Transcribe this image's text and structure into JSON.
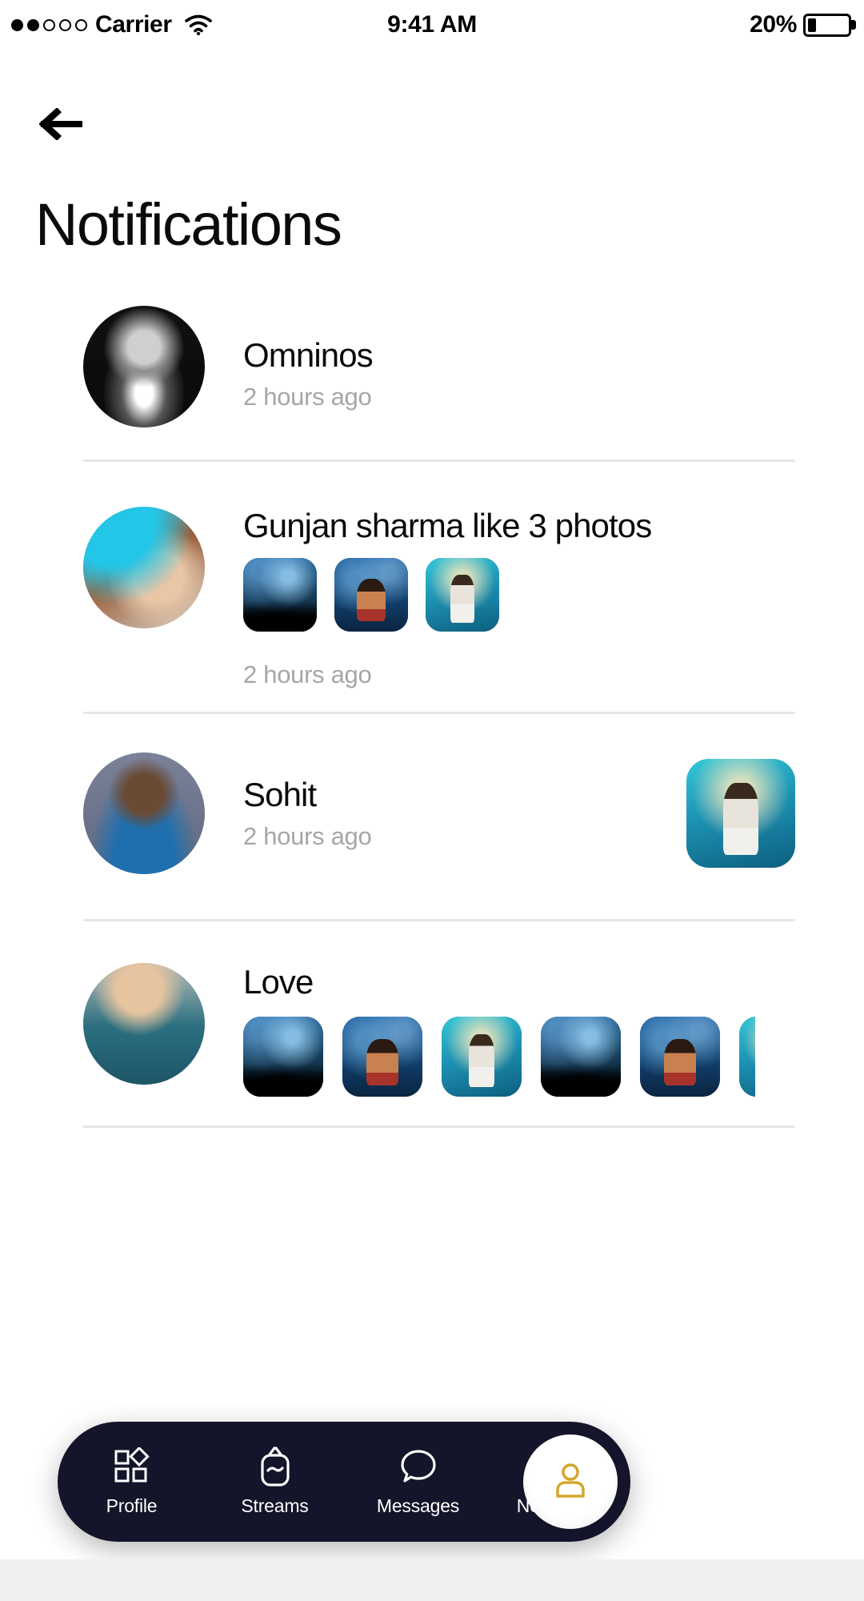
{
  "status_bar": {
    "carrier": "Carrier",
    "signal_dots_filled": 2,
    "signal_dots_total": 5,
    "wifi_icon": "wifi-icon",
    "time": "9:41 AM",
    "battery_percent": "20%",
    "battery_level": 20
  },
  "header": {
    "back_icon": "arrow-left-icon",
    "title": "Notifications"
  },
  "colors": {
    "nav_background": "#14142a",
    "accent_gold": "#d4a62a",
    "text_primary": "#0a0a0a",
    "text_muted": "#a6a6a6",
    "divider": "#e6e6e6",
    "page_background": "#ffffff"
  },
  "notifications": [
    {
      "id": "omninos",
      "name": "Omninos",
      "time": "2 hours ago",
      "avatar": "avatar-omninos",
      "layout": "simple",
      "thumbnails": []
    },
    {
      "id": "gunjan-sharma",
      "name": "Gunjan sharma like 3 photos",
      "time": "2 hours ago",
      "avatar": "avatar-gunjan-sharma",
      "layout": "thumbs-below",
      "thumbnails": [
        "photo-concert-crowd",
        "photo-guitarist-blue",
        "photo-singer-teal"
      ]
    },
    {
      "id": "sohit",
      "name": "Sohit",
      "time": "2 hours ago",
      "avatar": "avatar-sohit",
      "layout": "thumb-right",
      "thumbnails": [
        "photo-singer-teal"
      ]
    },
    {
      "id": "love",
      "name": "Love",
      "time": "",
      "avatar": "avatar-love",
      "layout": "thumbs-scroll",
      "thumbnails": [
        "photo-concert-crowd",
        "photo-guitarist-blue",
        "photo-singer-teal",
        "photo-concert-crowd",
        "photo-guitarist-blue",
        "photo-singer-teal"
      ]
    }
  ],
  "bottom_nav": {
    "items": [
      {
        "id": "profile",
        "label": "Profile",
        "icon": "grid-shapes-icon",
        "active": false
      },
      {
        "id": "streams",
        "label": "Streams",
        "icon": "tv-icon",
        "active": false
      },
      {
        "id": "messages",
        "label": "Messages",
        "icon": "chat-bubble-icon",
        "active": false
      },
      {
        "id": "notification",
        "label": "Notification",
        "icon": "bell-icon",
        "active": true
      }
    ],
    "user_button": {
      "icon": "user-avatar-icon",
      "label": ""
    }
  }
}
